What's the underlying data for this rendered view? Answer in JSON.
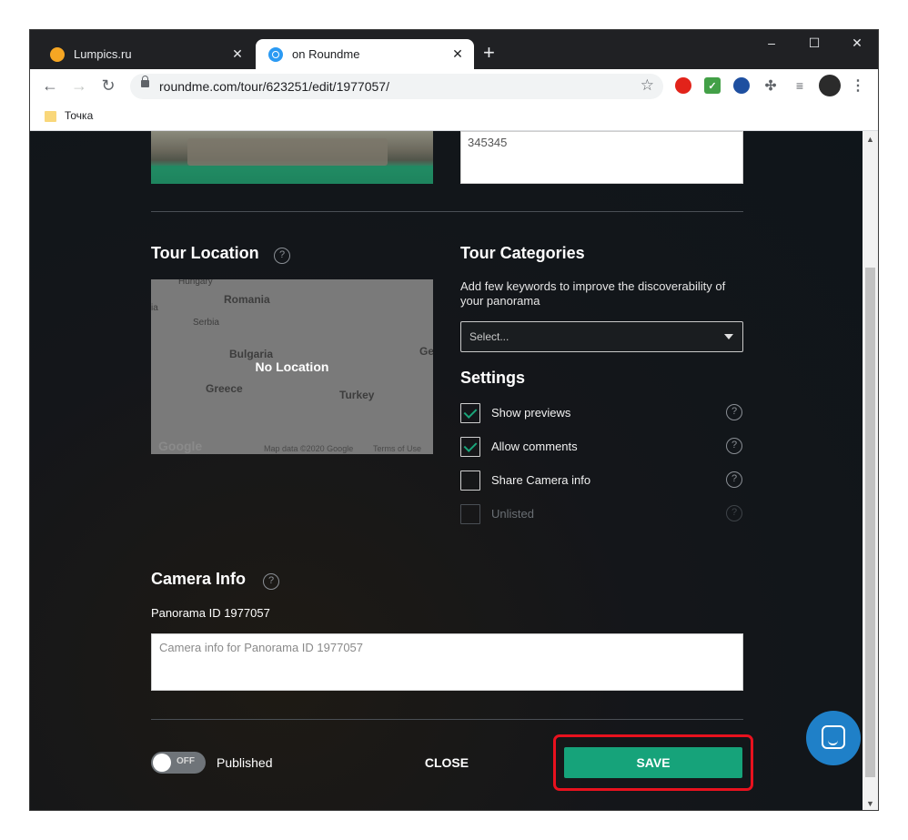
{
  "browser": {
    "tabs": [
      {
        "label": "Lumpics.ru",
        "active": false,
        "favicon": "orange-circle-icon"
      },
      {
        "label": "on Roundme",
        "active": true,
        "favicon": "roundme-icon"
      }
    ],
    "new_tab": "+",
    "window_controls": {
      "minimize": "–",
      "maximize": "☐",
      "close": "✕"
    },
    "url": "roundme.com/tour/623251/edit/1977057/",
    "bookmark_folder": "Точка"
  },
  "tour": {
    "description_value": "345345",
    "location": {
      "title": "Tour Location",
      "help": "?",
      "map_overlay": "No Location",
      "map_labels": {
        "hungary": "Hungary",
        "romania": "Romania",
        "serbia": "Serbia",
        "bulgaria": "Bulgaria",
        "greece": "Greece",
        "turkey": "Turkey",
        "ge": "Ge",
        "ia": "ia"
      },
      "map_logo": "Google",
      "map_attribution": "Map data ©2020 Google",
      "map_terms": "Terms of Use"
    },
    "categories": {
      "title": "Tour Categories",
      "hint": "Add few keywords to improve the discoverability of your panorama",
      "select_placeholder": "Select..."
    },
    "settings": {
      "title": "Settings",
      "items": [
        {
          "label": "Show previews",
          "checked": true,
          "enabled": true
        },
        {
          "label": "Allow comments",
          "checked": true,
          "enabled": true
        },
        {
          "label": "Share Camera info",
          "checked": false,
          "enabled": true
        },
        {
          "label": "Unlisted",
          "checked": false,
          "enabled": false
        }
      ]
    },
    "camera": {
      "title": "Camera Info",
      "help": "?",
      "panorama_id_label": "Panorama ID 1977057",
      "placeholder": "Camera info for Panorama ID 1977057"
    }
  },
  "footer": {
    "toggle_state": "OFF",
    "published_label": "Published",
    "close_label": "CLOSE",
    "save_label": "SAVE"
  },
  "colors": {
    "save_button": "#16a37a",
    "highlight": "#e8111e",
    "chat_button": "#1f80c8"
  }
}
